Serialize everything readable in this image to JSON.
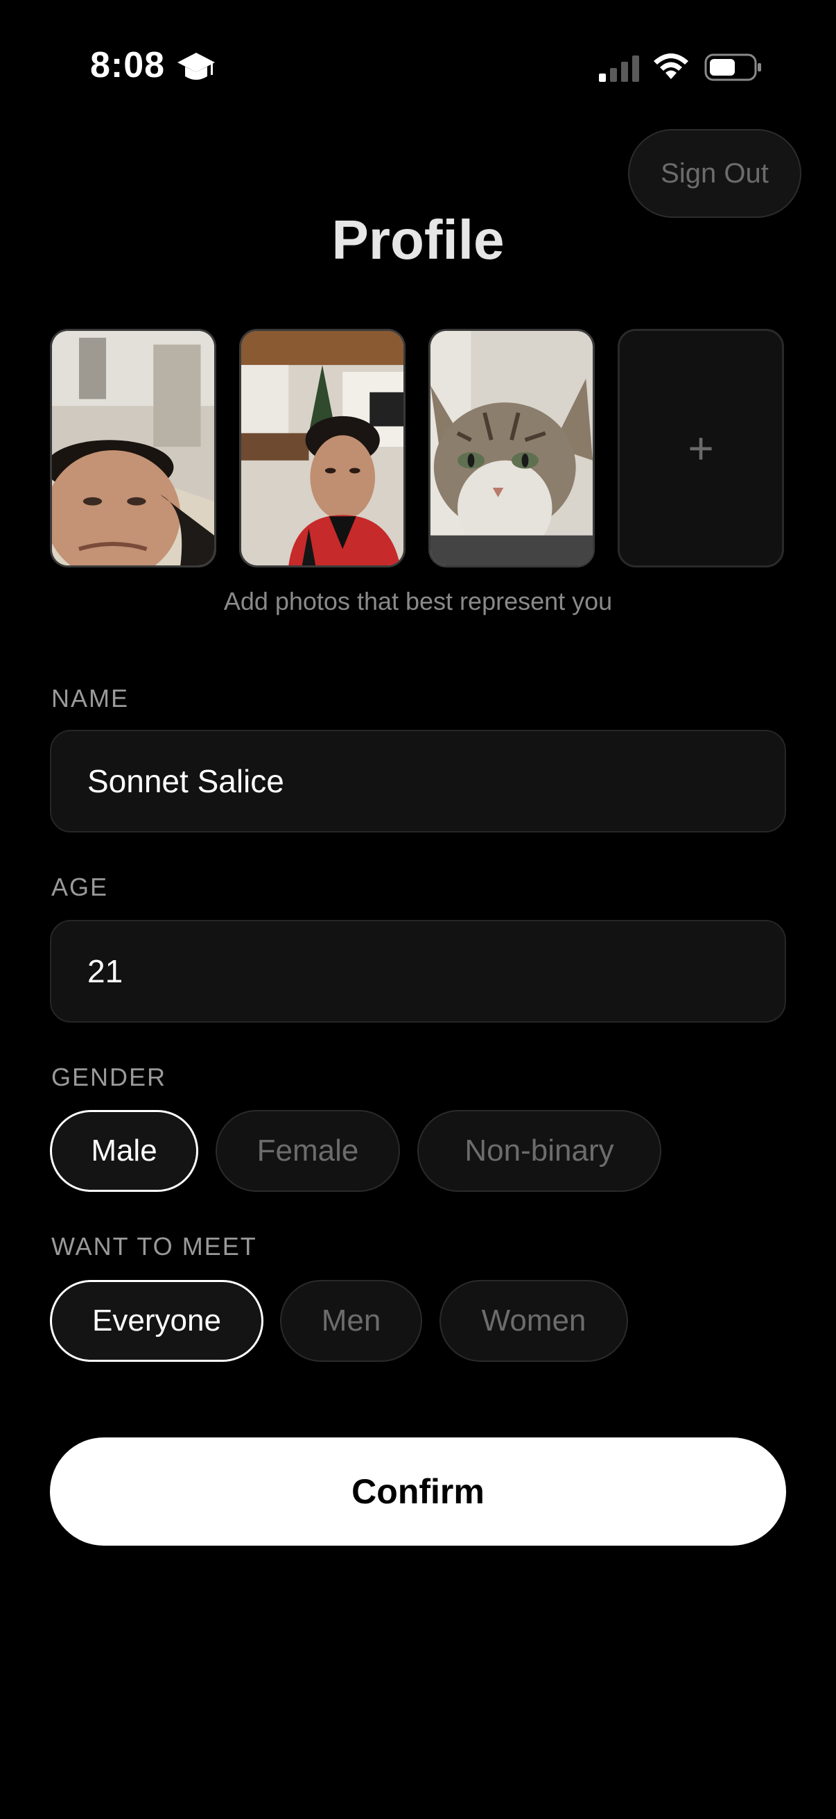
{
  "status_bar": {
    "time": "8:08",
    "icons": [
      "graduation-cap-icon",
      "cellular-signal-icon",
      "wifi-icon",
      "battery-icon"
    ]
  },
  "header": {
    "sign_out_label": "Sign Out",
    "title": "Profile"
  },
  "photos": {
    "items": [
      {
        "description": "selfie-1"
      },
      {
        "description": "selfie-2"
      },
      {
        "description": "cat-photo"
      }
    ],
    "add_icon": "+",
    "hint": "Add photos that best represent you"
  },
  "name": {
    "label": "NAME",
    "value": "Sonnet Salice"
  },
  "age": {
    "label": "AGE",
    "value": "21"
  },
  "gender": {
    "label": "GENDER",
    "options": [
      "Male",
      "Female",
      "Non-binary"
    ],
    "selected": "Male"
  },
  "want_to_meet": {
    "label": "WANT TO MEET",
    "options": [
      "Everyone",
      "Men",
      "Women"
    ],
    "selected": "Everyone"
  },
  "confirm_label": "Confirm",
  "colors": {
    "background": "#000000",
    "field_bg": "#121212",
    "selected_border": "#ffffff",
    "muted_text": "#6c6c6c",
    "confirm_bg": "#ffffff"
  }
}
